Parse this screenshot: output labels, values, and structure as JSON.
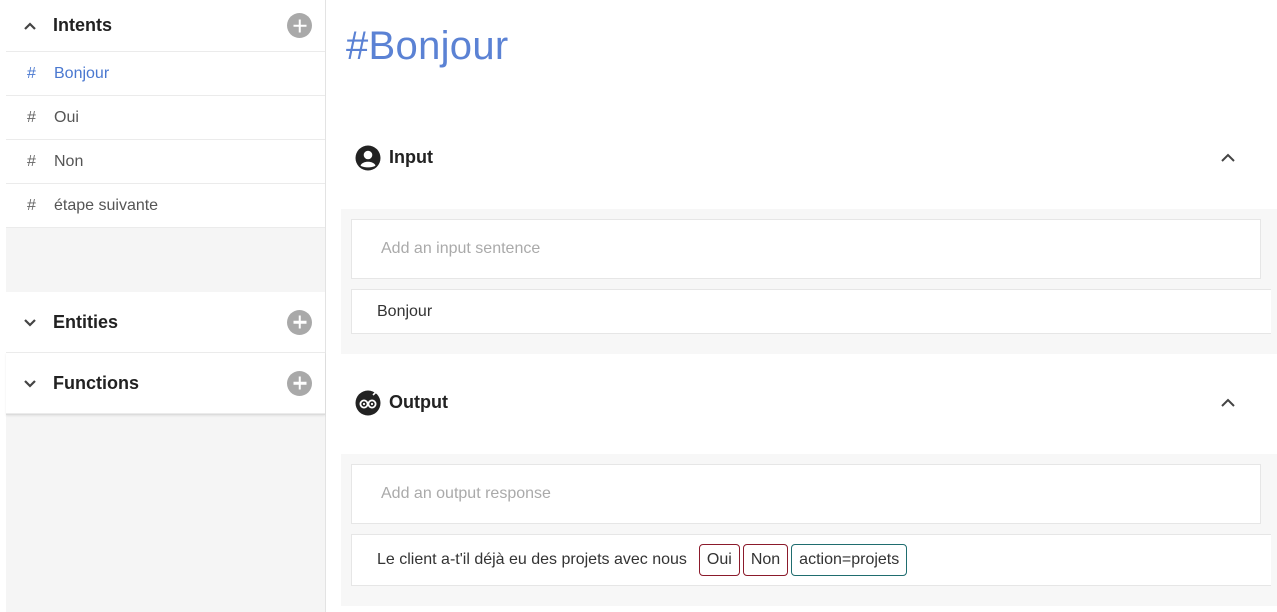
{
  "sidebar": {
    "intents": {
      "title": "Intents",
      "items": [
        {
          "hash": "#",
          "label": "Bonjour"
        },
        {
          "hash": "#",
          "label": "Oui"
        },
        {
          "hash": "#",
          "label": "Non"
        },
        {
          "hash": "#",
          "label": "étape suivante"
        }
      ]
    },
    "entities": {
      "title": "Entities"
    },
    "functions": {
      "title": "Functions"
    }
  },
  "main": {
    "title": "#Bonjour",
    "input_section": {
      "title": "Input",
      "placeholder": "Add an input sentence",
      "sentences": [
        "Bonjour"
      ]
    },
    "output_section": {
      "title": "Output",
      "placeholder": "Add an output response",
      "response_text": "Le client a-t'il déjà eu des projets avec nous",
      "chips": [
        {
          "label": "Oui",
          "color": "#8b1a2b"
        },
        {
          "label": "Non",
          "color": "#8b1a2b"
        },
        {
          "label": "action=projets",
          "color": "#1f6d6f"
        }
      ]
    }
  },
  "colors": {
    "accent": "#5b82d4",
    "active_item": "#4a78d0",
    "add_button": "#a9a9a9"
  }
}
